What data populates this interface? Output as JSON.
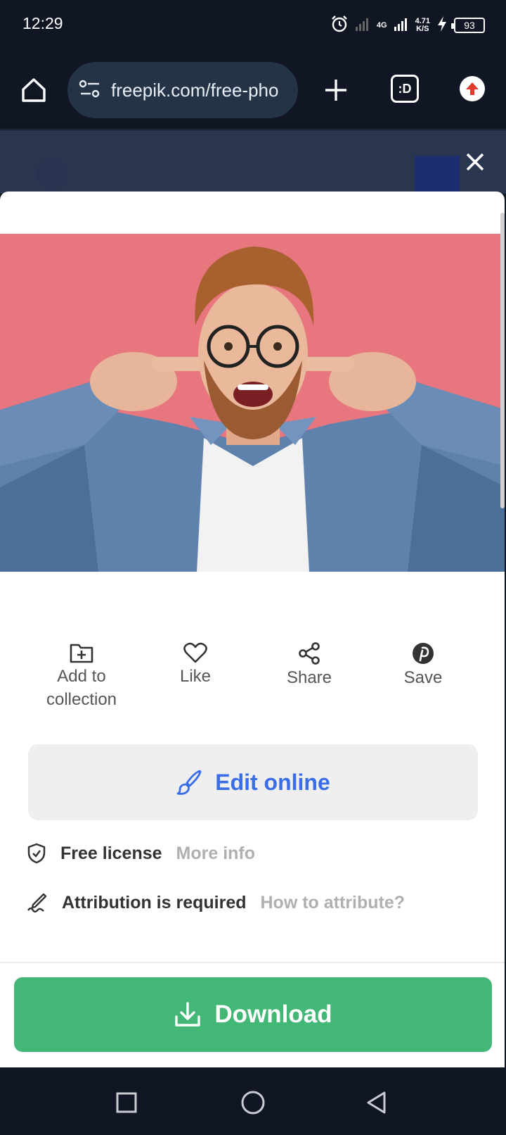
{
  "status_bar": {
    "time": "12:29",
    "network": "4G",
    "speed_value": "4.71",
    "speed_unit": "K/S",
    "battery": "93"
  },
  "browser": {
    "url": "freepik.com/free-pho",
    "tabs_label": ":D"
  },
  "actions": [
    {
      "label": "Add to collection",
      "icon": "folder-plus-icon"
    },
    {
      "label": "Like",
      "icon": "heart-icon"
    },
    {
      "label": "Share",
      "icon": "share-icon"
    },
    {
      "label": "Save",
      "icon": "pinterest-icon"
    }
  ],
  "edit": {
    "label": "Edit online",
    "icon": "brush-icon"
  },
  "license": {
    "free_label": "Free license",
    "free_link": "More info",
    "attribution_label": "Attribution is required",
    "attribution_link": "How to attribute?"
  },
  "download": {
    "label": "Download",
    "icon": "download-icon"
  },
  "colors": {
    "accent_blue": "#3a6ee8",
    "download_green": "#42b776",
    "photo_background": "#e87c83",
    "system_bar": "#101624"
  }
}
